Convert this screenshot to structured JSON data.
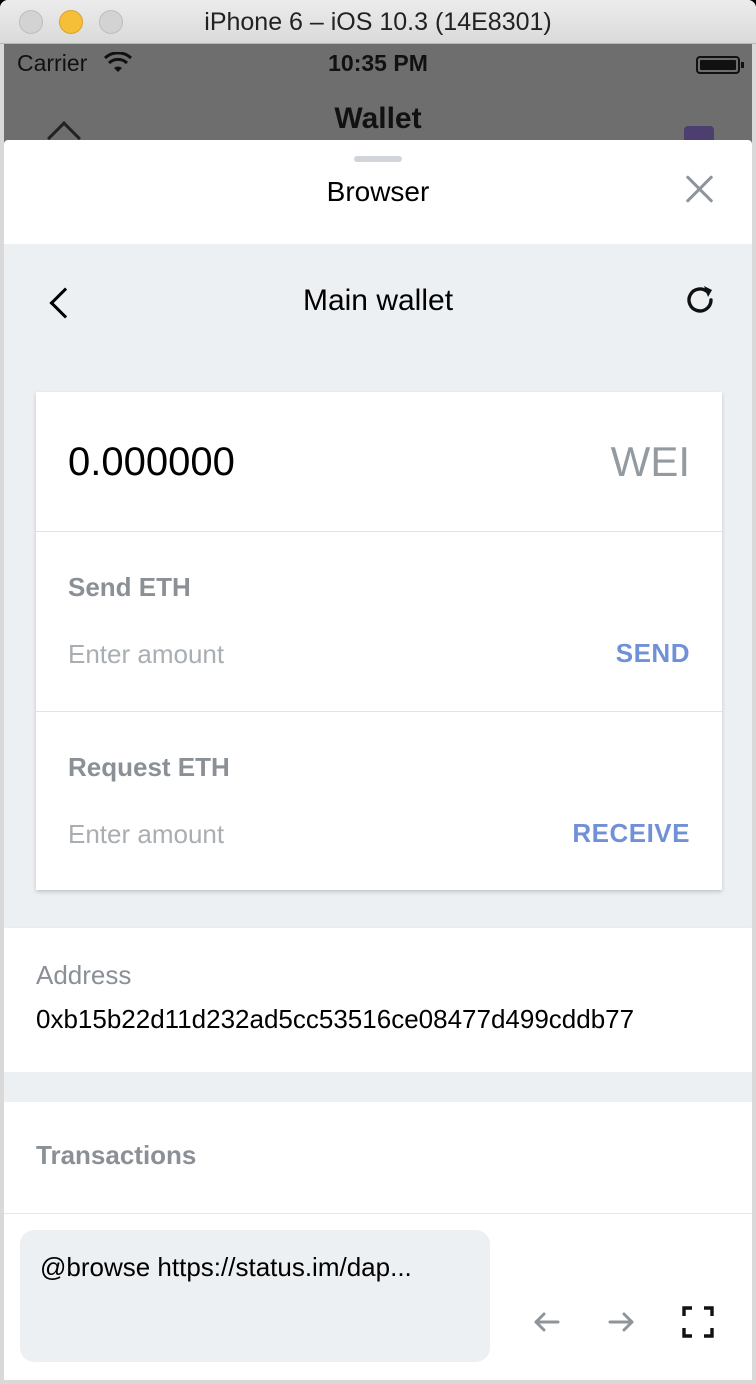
{
  "simulator": {
    "window_title": "iPhone 6 – iOS 10.3 (14E8301)"
  },
  "status_bar": {
    "carrier": "Carrier",
    "time": "10:35 PM"
  },
  "background_screen": {
    "title": "Wallet"
  },
  "sheet": {
    "title": "Browser"
  },
  "toolbar": {
    "title": "Main wallet"
  },
  "balance": {
    "value": "0.000000",
    "unit": "WEI"
  },
  "send": {
    "label": "Send ETH",
    "placeholder": "Enter amount",
    "action": "SEND"
  },
  "request": {
    "label": "Request ETH",
    "placeholder": "Enter amount",
    "action": "RECEIVE"
  },
  "address": {
    "label": "Address",
    "value": "0xb15b22d11d232ad5cc53516ce08477d499cddb77"
  },
  "transactions": {
    "label": "Transactions"
  },
  "browser_bar": {
    "url_text": "@browse https://status.im/dap..."
  },
  "colors": {
    "accent": "#7090d8",
    "muted_text": "#8a9096",
    "panel_background": "#edf0f3"
  }
}
